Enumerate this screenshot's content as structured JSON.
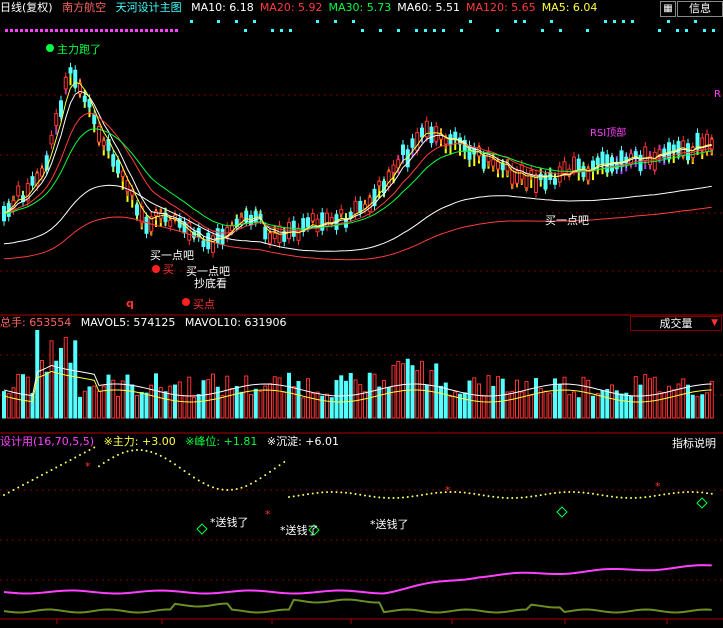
{
  "price_panel": {
    "period": "日线(复权)",
    "stock_name": "南方航空",
    "indicator_name": "天河设计主图",
    "ma_items": [
      {
        "label": "MA10: 6.18",
        "color": "#ffffff"
      },
      {
        "label": "MA20: 5.92",
        "color": "#ff3b3b"
      },
      {
        "label": "MA30: 5.73",
        "color": "#00ff40"
      },
      {
        "label": "MA60: 5.51",
        "color": "#ffffff"
      },
      {
        "label": "MA120: 5.65",
        "color": "#ff3b3b"
      },
      {
        "label": "MA5: 6.04",
        "color": "#ffff40"
      }
    ],
    "annotations": {
      "main_run": "主力跑了",
      "buy_little_1": "买一点吧",
      "buy_little_2": "买一点吧",
      "buy_little_3": "买一点吧",
      "bottom_fish": "抄底看",
      "buy_point": "买点",
      "buy_short": "买",
      "rsi_top": "RSI顶部",
      "red_q": "q",
      "right_r": "R"
    }
  },
  "toolbar": {
    "info_label": "信息"
  },
  "volume_panel": {
    "title": "总手: 653554",
    "mavol5": "MAVOL5: 574125",
    "mavol10": "MAVOL10: 631906",
    "selector_label": "成交量"
  },
  "indicator_panel": {
    "title": "设计用(16,70,5,5)",
    "main_force": "※主力: +3.00",
    "peak": "※峰位: +1.81",
    "sink": "※沉淀: +6.01",
    "explain_button": "指标说明",
    "annotations": {
      "send_money_1": "*送钱了",
      "send_money_2": "*送钱了",
      "send_money_3": "*送钱了"
    }
  },
  "colors": {
    "up": "#ff3232",
    "down": "#54ffff",
    "grid": "#800000",
    "ma10": "#ffffff",
    "ma20": "#ff3b3b",
    "ma30": "#00ff40",
    "ma5": "#ffff40",
    "band": "#ffff00",
    "band_purple": "#a040ff"
  }
}
